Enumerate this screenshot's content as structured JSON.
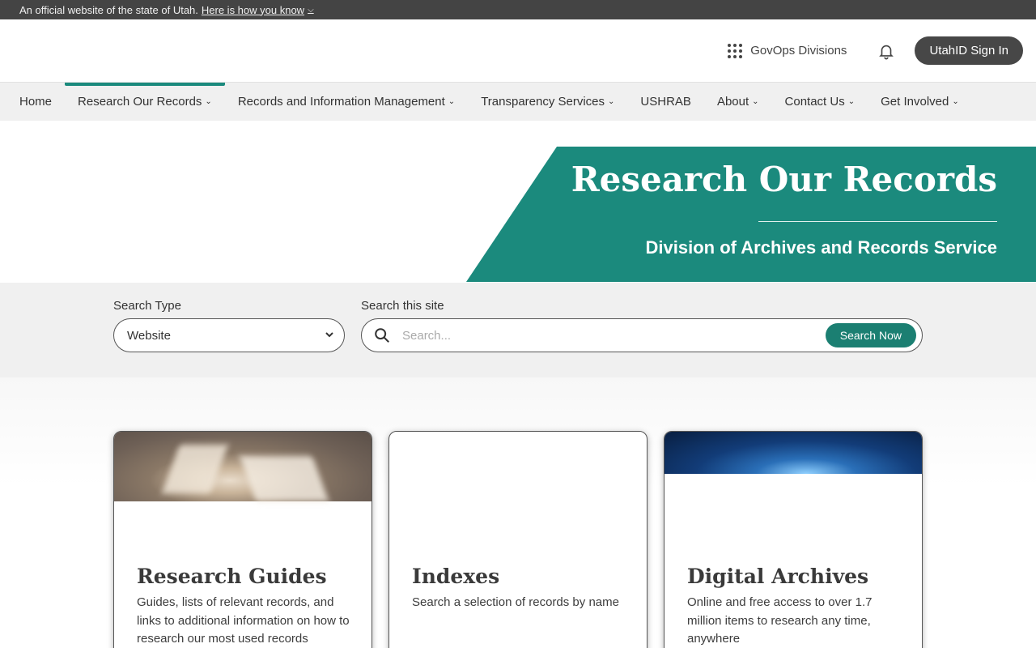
{
  "official_bar": {
    "text": "An official website of the state of Utah.",
    "link_label": "Here is how you know"
  },
  "header": {
    "divisions_label": "GovOps Divisions",
    "signin_label": "UtahID Sign In"
  },
  "nav": {
    "items": [
      {
        "label": "Home",
        "has_caret": false
      },
      {
        "label": "Research Our Records",
        "has_caret": true,
        "active": true
      },
      {
        "label": "Records and Information Management",
        "has_caret": true
      },
      {
        "label": "Transparency Services",
        "has_caret": true
      },
      {
        "label": "USHRAB",
        "has_caret": false
      },
      {
        "label": "About",
        "has_caret": true
      },
      {
        "label": "Contact Us",
        "has_caret": true
      },
      {
        "label": "Get Involved",
        "has_caret": true
      }
    ]
  },
  "banner": {
    "title": "Research Our Records",
    "subtitle": "Division of Archives and Records Service"
  },
  "search": {
    "type_label": "Search Type",
    "type_value": "Website",
    "site_label": "Search this site",
    "placeholder": "Search...",
    "button_label": "Search Now"
  },
  "cards": [
    {
      "title": "Research Guides",
      "description": "Guides, lists of relevant records, and links to additional information on how to research our most used records"
    },
    {
      "title": "Indexes",
      "description": "Search a selection of records by name"
    },
    {
      "title": "Digital Archives",
      "description": "Online and free access to over 1.7 million items to research any time, anywhere"
    }
  ],
  "colors": {
    "accent": "#1b8a7d",
    "official_bar": "#444444",
    "nav_bg": "#f0f0f0"
  }
}
